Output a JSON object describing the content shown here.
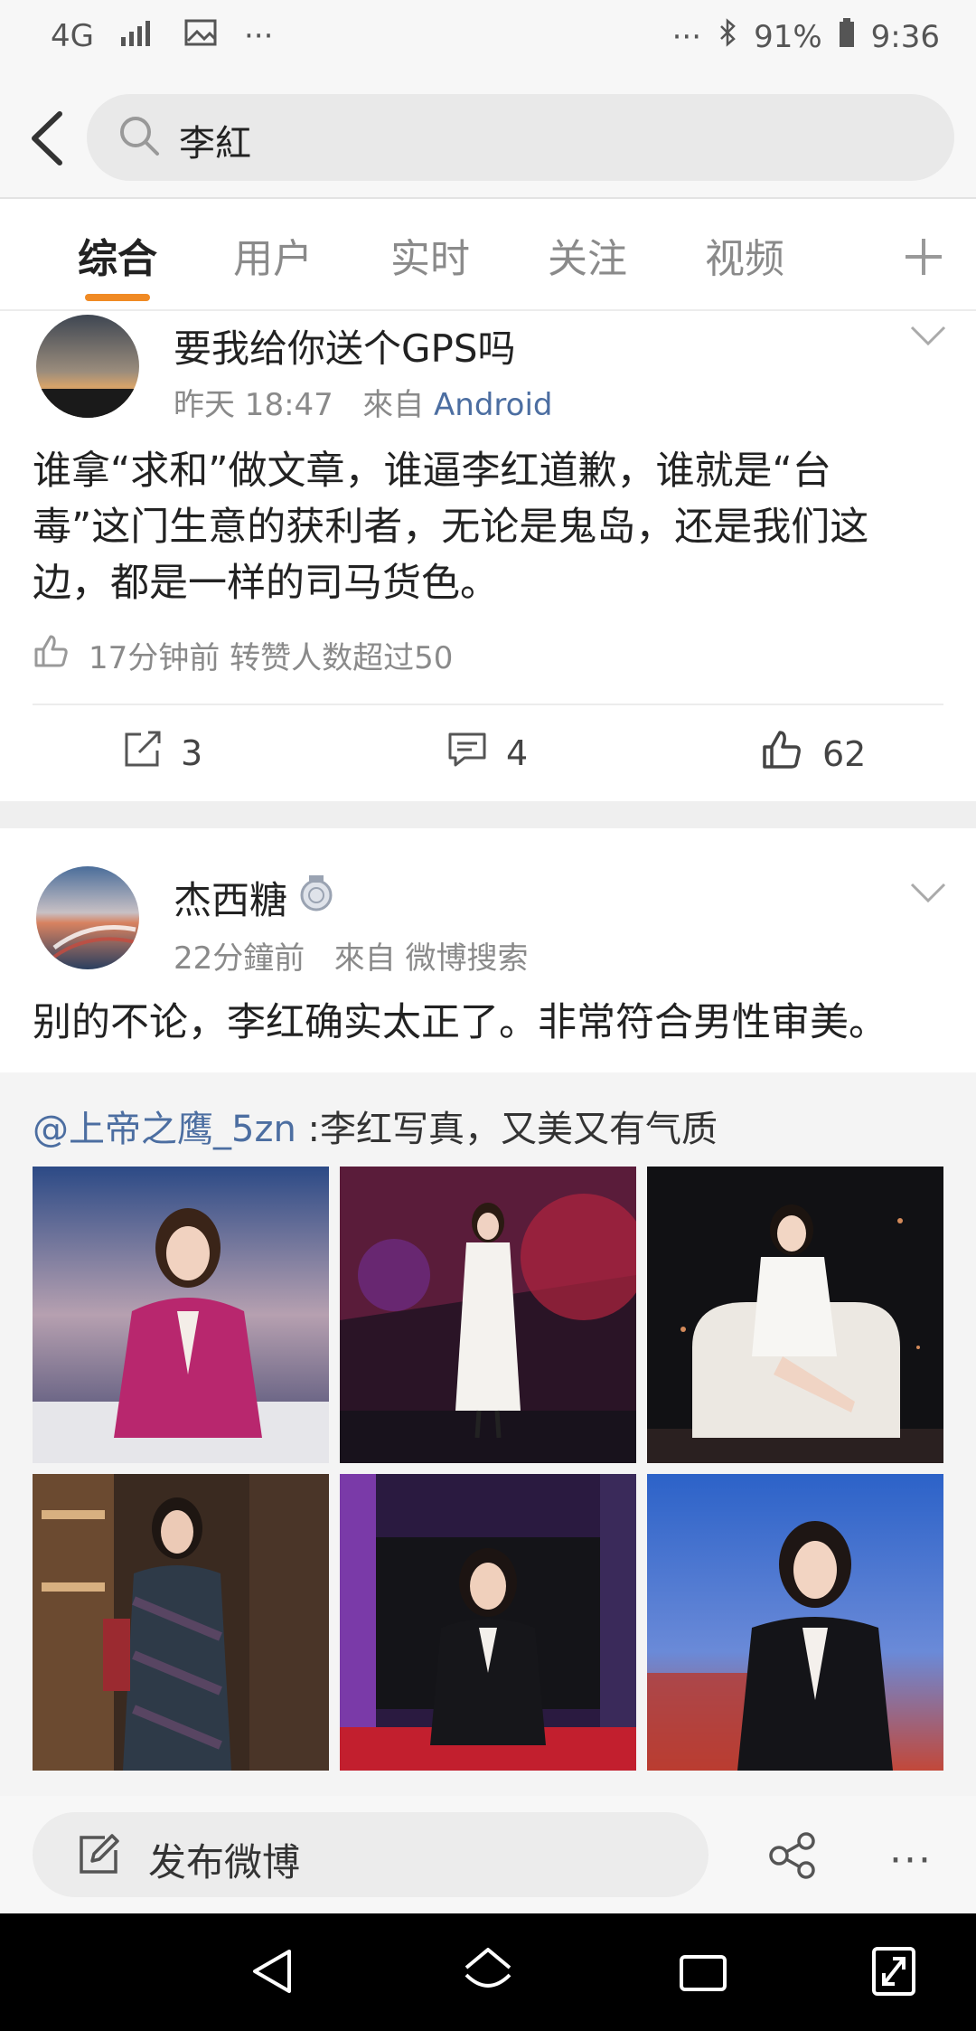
{
  "status_bar": {
    "network": "4G",
    "battery": "91%",
    "time": "9:36"
  },
  "search": {
    "query": "李紅"
  },
  "tabs": [
    {
      "label": "综合",
      "active": true
    },
    {
      "label": "用户"
    },
    {
      "label": "实时"
    },
    {
      "label": "关注"
    },
    {
      "label": "视频"
    }
  ],
  "posts": [
    {
      "author": "要我给你送个GPS吗",
      "time": "昨天 18:47",
      "from_prefix": "來自",
      "source": "Android",
      "text_lines": [
        "谁拿“求和”做文章，谁逼李红道歉，谁就是“台",
        "毒”这门生意的获利者，无论是鬼岛，还是我们这",
        "边，都是一样的司马货色。"
      ],
      "like_note": "17分钟前 转赞人数超过50",
      "reposts": "3",
      "comments": "4",
      "likes": "62"
    },
    {
      "author": "杰西糖",
      "time": "22分鐘前",
      "from_prefix": "來自",
      "source": "微博搜索",
      "text": "别的不论，李红确实太正了。非常符合男性审美。",
      "quote_handle": "@上帝之鹰_5zn",
      "quote_text": ":李红写真，又美又有气质"
    }
  ],
  "bottom": {
    "compose_label": "发布微博"
  },
  "colors": {
    "accent": "#f08a24",
    "link": "#4c6ea1"
  }
}
